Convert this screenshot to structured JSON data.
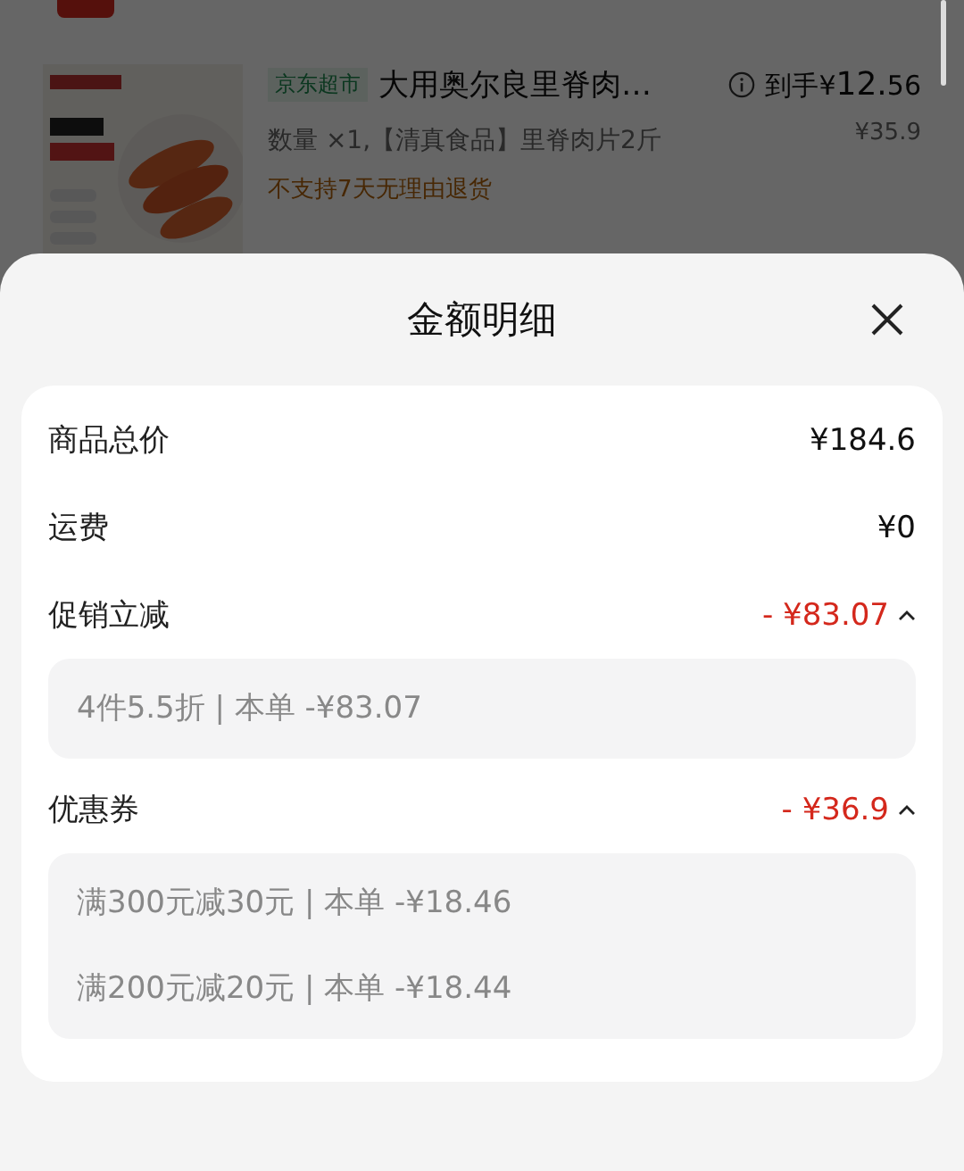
{
  "background": {
    "item": {
      "kind": "picture",
      "store_tag": "京东超市",
      "title": "大用奥尔良里脊肉…",
      "final_price_label": "到手¥",
      "final_price_int": "12.",
      "final_price_dec": "56",
      "spec": "数量 ×1,【清真食品】里脊肉片2斤",
      "original_price_int": "¥35.",
      "original_price_dec": "9",
      "notice": "不支持7天无理由退货"
    }
  },
  "sheet": {
    "title": "金额明细",
    "rows": [
      {
        "kind": "plain",
        "label": "商品总价",
        "amount": "¥184.6"
      },
      {
        "kind": "plain",
        "label": "运费",
        "amount": "¥0"
      },
      {
        "kind": "discount",
        "label": "促销立减",
        "amount": "- ¥83.07",
        "expanded": true,
        "details": [
          "4件5.5折 | 本单 -¥83.07"
        ]
      },
      {
        "kind": "discount",
        "label": "优惠券",
        "amount": "- ¥36.9",
        "expanded": true,
        "details": [
          "满300元减30元 | 本单 -¥18.46",
          "满200元减20元 | 本单 -¥18.44"
        ]
      }
    ]
  }
}
